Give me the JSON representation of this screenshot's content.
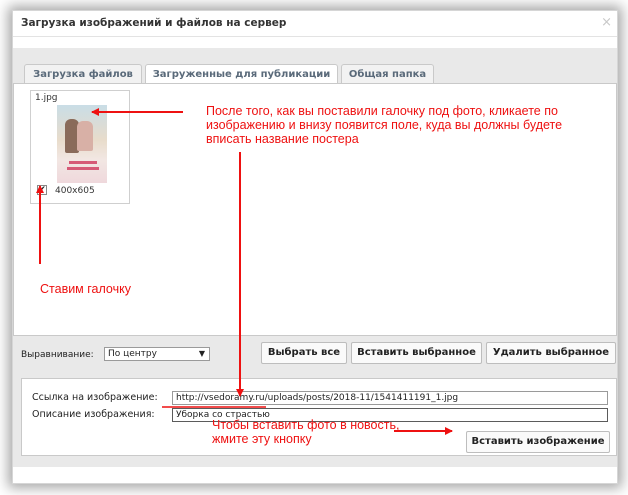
{
  "dialog": {
    "title": "Загрузка изображений и файлов на сервер",
    "close_symbol": "×"
  },
  "tabs": [
    {
      "label": "Загрузка файлов",
      "active": false
    },
    {
      "label": "Загруженные для публикации",
      "active": true
    },
    {
      "label": "Общая папка",
      "active": false
    }
  ],
  "image": {
    "filename": "1.jpg",
    "dimensions": "400x605",
    "checked": true,
    "check_symbol": "✔"
  },
  "annotations": {
    "click_image": "После того, как вы поставили галочку под фото, кликаете по изображению и внизу появится поле, куда вы должны будете вписать название постера",
    "check_box": "Ставим галочку",
    "insert_button": "Чтобы вставить фото в новость, жмите эту кнопку",
    "color": "#ee1111"
  },
  "controls": {
    "align_label": "Выравнивание:",
    "align_value": "По центру",
    "select_all": "Выбрать все",
    "insert_selected": "Вставить выбранное",
    "delete_selected": "Удалить выбранное"
  },
  "link_form": {
    "link_label": "Ссылка на изображение:",
    "link_value": "http://vsedoramy.ru/uploads/posts/2018-11/1541411191_1.jpg",
    "desc_label": "Описание изображения:",
    "desc_value": "Уборка со страстью",
    "insert_button": "Вставить изображение"
  }
}
